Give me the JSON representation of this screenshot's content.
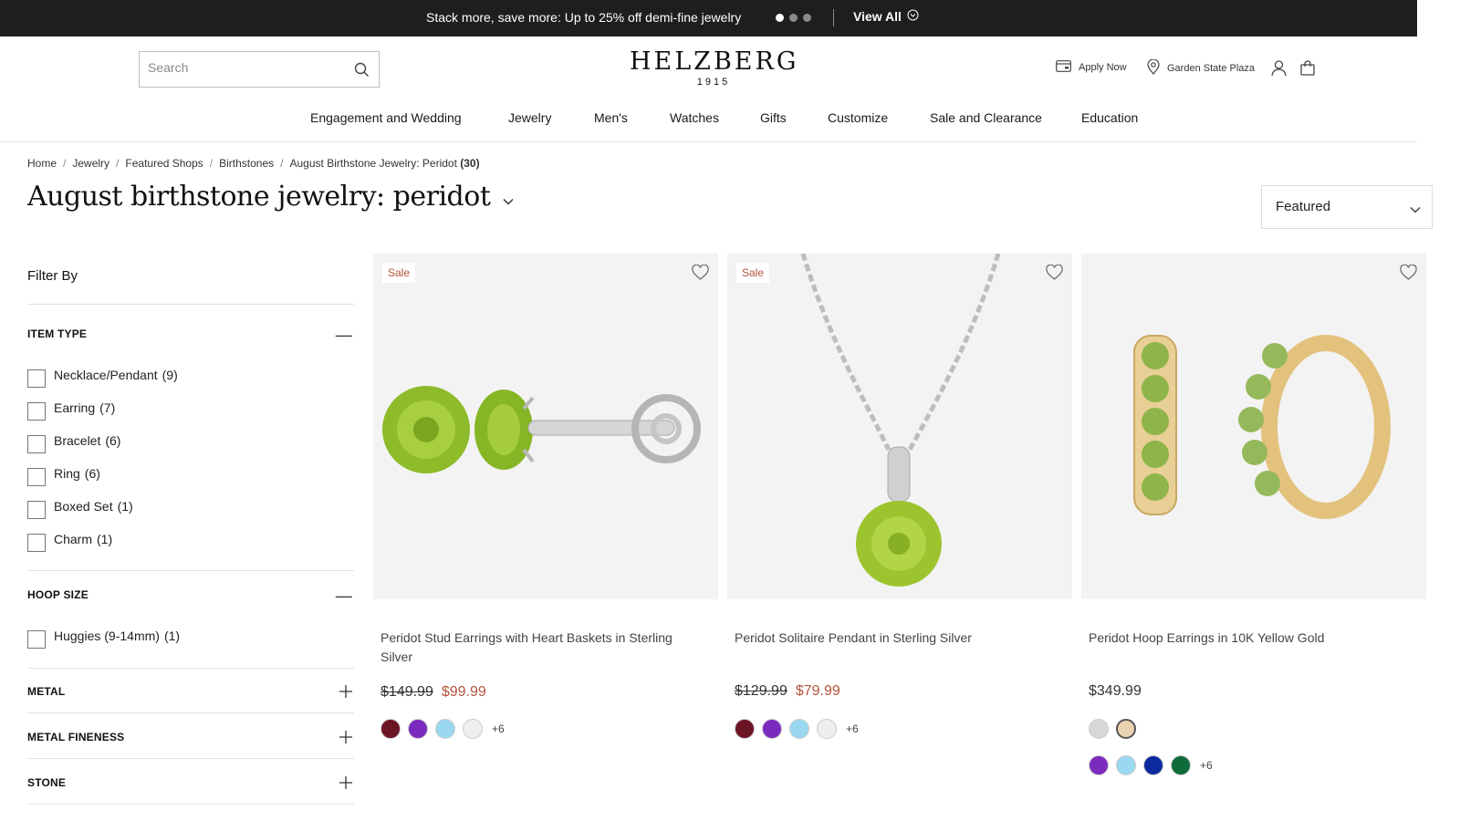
{
  "promo": {
    "text": "Stack more, save more: Up to 25% off demi-fine jewelry",
    "view_all": "View All"
  },
  "header": {
    "search_placeholder": "Search",
    "logo_name": "HELZBERG",
    "logo_year": "1915",
    "apply_now": "Apply Now",
    "store": "Garden State Plaza"
  },
  "nav": {
    "items": [
      "Engagement and Wedding",
      "Jewelry",
      "Men's",
      "Watches",
      "Gifts",
      "Customize",
      "Sale and Clearance",
      "Education"
    ]
  },
  "breadcrumb": {
    "items": [
      "Home",
      "Jewelry",
      "Featured Shops",
      "Birthstones"
    ],
    "current": "August Birthstone Jewelry: Peridot",
    "count": "(30)"
  },
  "page": {
    "title": "August birthstone jewelry: peridot",
    "sort_label": "Featured"
  },
  "filters": {
    "title": "Filter By",
    "item_type": {
      "label": "ITEM TYPE",
      "options": [
        {
          "label": "Necklace/Pendant",
          "count": "(9)"
        },
        {
          "label": "Earring",
          "count": "(7)"
        },
        {
          "label": "Bracelet",
          "count": "(6)"
        },
        {
          "label": "Ring",
          "count": "(6)"
        },
        {
          "label": "Boxed Set",
          "count": "(1)"
        },
        {
          "label": "Charm",
          "count": "(1)"
        }
      ]
    },
    "hoop_size": {
      "label": "HOOP SIZE",
      "options": [
        {
          "label": "Huggies (9-14mm)",
          "count": "(1)"
        }
      ]
    },
    "metal": {
      "label": "METAL"
    },
    "metal_fineness": {
      "label": "METAL FINENESS"
    },
    "stone": {
      "label": "STONE"
    }
  },
  "products": [
    {
      "badge": "Sale",
      "name": "Peridot Stud Earrings with Heart Baskets in Sterling Silver",
      "old_price": "$149.99",
      "new_price": "$99.99",
      "swatches": [
        "#6b1424",
        "#7b2cbf",
        "#9ad8f0",
        "#eeeeee"
      ],
      "more": "+6"
    },
    {
      "badge": "Sale",
      "name": "Peridot Solitaire Pendant in Sterling Silver",
      "old_price": "$129.99",
      "new_price": "$79.99",
      "swatches": [
        "#6b1424",
        "#7b2cbf",
        "#9ad8f0",
        "#eeeeee"
      ],
      "more": "+6"
    },
    {
      "name": "Peridot Hoop Earrings in 10K Yellow Gold",
      "price": "$349.99",
      "metal_swatches": [
        "#d7d7d7",
        "#e9d3b0"
      ],
      "swatches": [
        "#7b2cbf",
        "#9ad8f0",
        "#0d2a9e",
        "#0f6b3a"
      ],
      "more": "+6"
    }
  ]
}
